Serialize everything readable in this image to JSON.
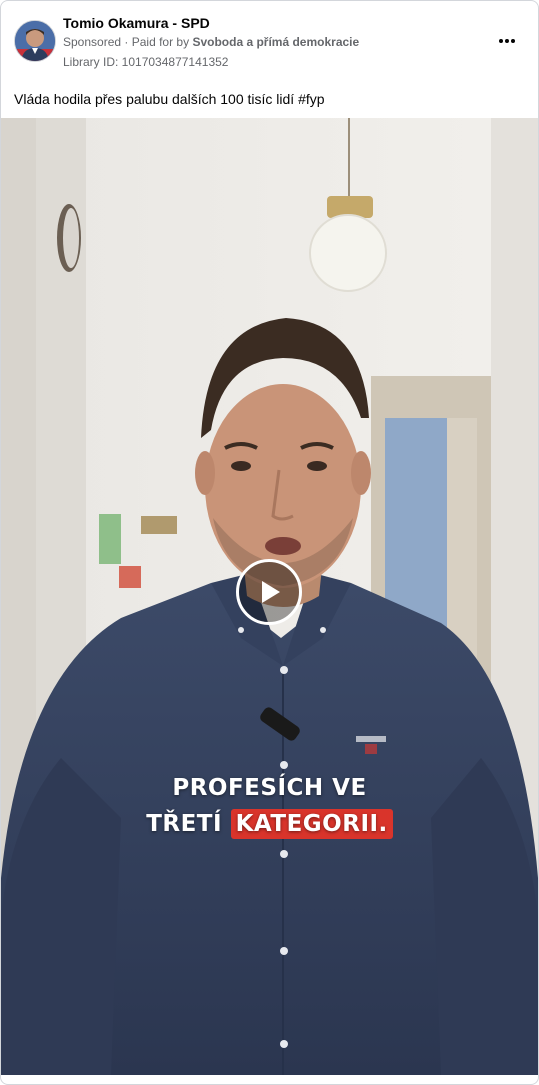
{
  "post": {
    "page_name": "Tomio Okamura - SPD",
    "sponsored_label": "Sponsored",
    "paid_for_prefix": "Paid for by",
    "payer": "Svoboda a přímá demokracie",
    "library_id": "Library ID: 1017034877141352",
    "caption": "Vláda hodila přes palubu dalších 100 tisíc lidí #fyp"
  },
  "video": {
    "overlay_line1": "PROFESÍCH VE",
    "overlay_line2_plain": "TŘETÍ",
    "overlay_line2_highlight": "KATEGORII.",
    "highlight_color": "#d9342b"
  },
  "icons": {
    "more": "more-options-icon",
    "play": "play-icon"
  }
}
